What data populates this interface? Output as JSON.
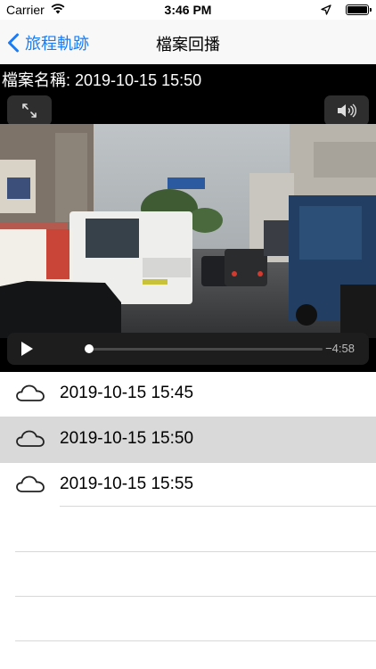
{
  "status": {
    "carrier": "Carrier",
    "time": "3:46 PM"
  },
  "nav": {
    "back_label": "旅程軌跡",
    "title": "檔案回播"
  },
  "player": {
    "file_label": "檔案名稱: 2019-10-15 15:50",
    "remaining": "−4:58",
    "progress": 0.02
  },
  "files": [
    {
      "label": "2019-10-15 15:45",
      "selected": false,
      "icon": "cloud-icon"
    },
    {
      "label": "2019-10-15 15:50",
      "selected": true,
      "icon": "cloud-icon"
    },
    {
      "label": "2019-10-15 15:55",
      "selected": false,
      "icon": "cloud-icon"
    }
  ],
  "colors": {
    "accent": "#1a7cf5",
    "selected_row": "#d9d9d9"
  }
}
